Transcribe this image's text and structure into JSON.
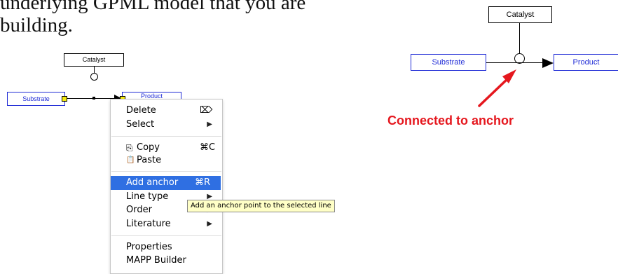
{
  "document": {
    "line1": "underlying GPML model that you are",
    "line2": "building."
  },
  "left_diagram": {
    "catalyst": "Catalyst",
    "substrate": "Substrate",
    "product": "Product"
  },
  "context_menu": {
    "items": [
      {
        "label": "Delete",
        "shortcut": "⌦"
      },
      {
        "label": "Select",
        "submenu": "▶"
      },
      {
        "label": "Copy",
        "icon": "⎘",
        "shortcut": "⌘C"
      },
      {
        "label": "Paste",
        "icon": "📋"
      },
      {
        "label": "Add anchor",
        "shortcut": "⌘R",
        "highlighted": true
      },
      {
        "label": "Line type",
        "submenu": "▶"
      },
      {
        "label": "Order",
        "submenu": "▶"
      },
      {
        "label": "Literature",
        "submenu": "▶"
      },
      {
        "label": "Properties"
      },
      {
        "label": "MAPP Builder"
      }
    ]
  },
  "tooltip": "Add an anchor point to the selected line",
  "right_diagram": {
    "catalyst": "Catalyst",
    "substrate": "Substrate",
    "product": "Product",
    "annotation": "Connected to anchor"
  },
  "colors": {
    "node_blue": "#1f2bd6",
    "handle_yellow": "#f5ea12",
    "menu_highlight": "#2f6fe2",
    "tooltip_bg": "#ffffc6",
    "annotation_red": "#e5171e"
  }
}
